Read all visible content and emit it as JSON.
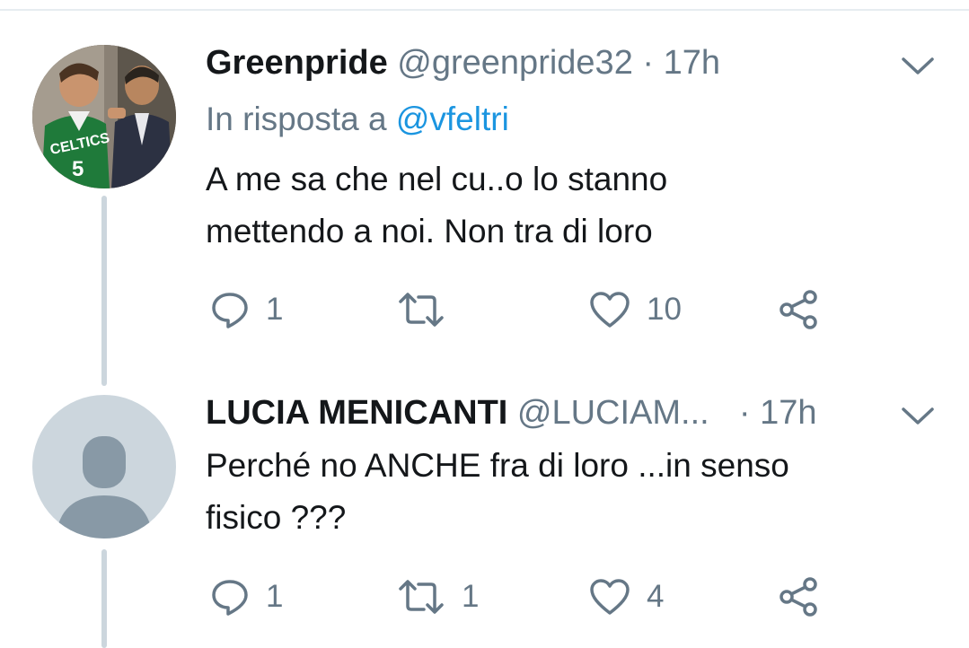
{
  "tweets": [
    {
      "name": "Greenpride",
      "handle": "@greenpride32",
      "separator": "·",
      "time": "17h",
      "reply_prefix": "In risposta a",
      "reply_mention": "@vfeltri",
      "text_lines": [
        "A me sa che nel cu..o lo stanno",
        "mettendo a noi. Non tra di loro"
      ],
      "replies": "1",
      "retweets": "",
      "likes": "10",
      "avatar_text": "CELTICS",
      "avatar_number": "5"
    },
    {
      "name": "LUCIA MENICANTI",
      "handle": "@LUCIAM...",
      "separator": "·",
      "time": "17h",
      "text_lines": [
        "Perché no ANCHE fra di loro ...in senso",
        "fisico ???"
      ],
      "replies": "1",
      "retweets": "1",
      "likes": "4"
    }
  ],
  "icons": {
    "reply": "reply-bubble-icon",
    "retweet": "retweet-arrows-icon",
    "like": "heart-icon",
    "share": "share-icon",
    "menu": "chevron-down-icon",
    "default_avatar": "default-user-icon"
  },
  "colors": {
    "text": "#14171a",
    "secondary": "#657786",
    "link": "#1b95e0",
    "thread_line": "#ccd6dd",
    "default_avatar_bg": "#ccd6dd",
    "default_avatar_fg": "#8899a6"
  }
}
